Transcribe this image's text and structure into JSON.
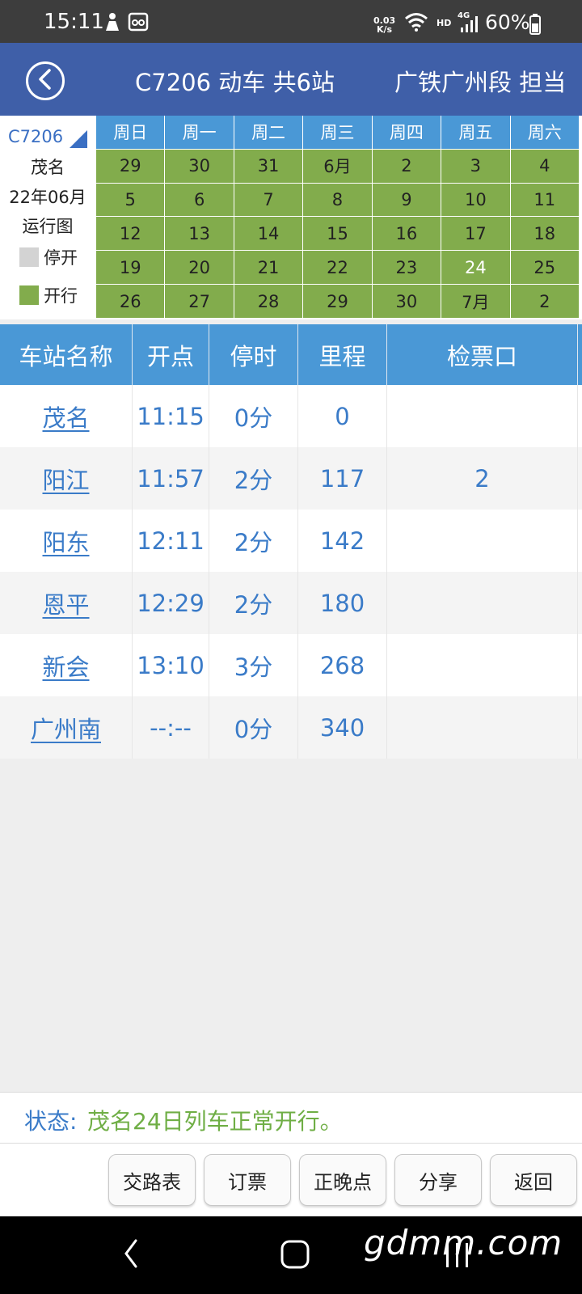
{
  "status_bar": {
    "time": "15:11",
    "net_speed_value": "0.03",
    "net_speed_unit": "K/s",
    "hd_label": "HD",
    "lte_label": "4G",
    "battery_text": "60%"
  },
  "header": {
    "title": "C7206 动车 共6站",
    "bureau": "广铁广州段 担当"
  },
  "calendar": {
    "train_code": "C7206",
    "origin": "茂名",
    "month_label": "22年06月",
    "chart_label": "运行图",
    "legend_stopped": "停开",
    "legend_running": "开行",
    "stopped_color": "#d3d3d3",
    "running_color": "#82ac4c",
    "weekdays": [
      "周日",
      "周一",
      "周二",
      "周三",
      "周四",
      "周五",
      "周六"
    ],
    "rows": [
      [
        "29",
        "30",
        "31",
        "6月",
        "2",
        "3",
        "4"
      ],
      [
        "5",
        "6",
        "7",
        "8",
        "9",
        "10",
        "11"
      ],
      [
        "12",
        "13",
        "14",
        "15",
        "16",
        "17",
        "18"
      ],
      [
        "19",
        "20",
        "21",
        "22",
        "23",
        "24",
        "25"
      ],
      [
        "26",
        "27",
        "28",
        "29",
        "30",
        "7月",
        "2"
      ]
    ],
    "today": "24"
  },
  "table": {
    "headers": {
      "station": "车站名称",
      "depart": "开点",
      "stop": "停时",
      "mileage": "里程",
      "gate": "检票口"
    },
    "rows": [
      {
        "station": "茂名",
        "depart": "11:15",
        "stop": "0分",
        "mileage": "0",
        "gate": ""
      },
      {
        "station": "阳江",
        "depart": "11:57",
        "stop": "2分",
        "mileage": "117",
        "gate": "2"
      },
      {
        "station": "阳东",
        "depart": "12:11",
        "stop": "2分",
        "mileage": "142",
        "gate": ""
      },
      {
        "station": "恩平",
        "depart": "12:29",
        "stop": "2分",
        "mileage": "180",
        "gate": ""
      },
      {
        "station": "新会",
        "depart": "13:10",
        "stop": "3分",
        "mileage": "268",
        "gate": ""
      },
      {
        "station": "广州南",
        "depart": "--:--",
        "stop": "0分",
        "mileage": "340",
        "gate": ""
      }
    ]
  },
  "status": {
    "label": "状态:",
    "text": "茂名24日列车正常开行。"
  },
  "buttons": {
    "routing": "交路表",
    "booking": "订票",
    "punctuality": "正晚点",
    "share": "分享",
    "back": "返回"
  },
  "watermark": "gdmm.com",
  "colors": {
    "header_bg": "#3f5fa8",
    "table_header_bg": "#4a98d6",
    "link_blue": "#3a7bc8",
    "status_green": "#6fae45"
  }
}
